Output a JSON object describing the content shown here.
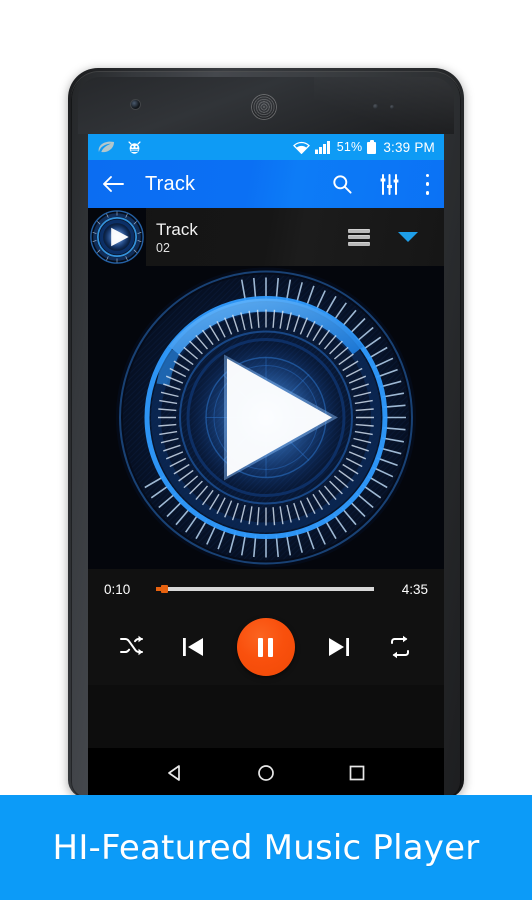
{
  "statusbar": {
    "icons_left": [
      "leaf-icon",
      "bug-icon"
    ],
    "wifi_icon": "wifi-icon",
    "signal_icon": "signal-bars-icon",
    "battery_percent": "51%",
    "battery_icon": "battery-icon",
    "clock": "3:39 PM"
  },
  "appbar": {
    "back_icon": "back-arrow-icon",
    "title": "Track",
    "search_icon": "search-icon",
    "equalizer_icon": "equalizer-icon",
    "overflow_icon": "overflow-menu-icon"
  },
  "nowplaying": {
    "art_icon": "album-art-play-icon",
    "title": "Track",
    "subtitle": "02",
    "queue_icon": "queue-list-icon",
    "collapse_icon": "chevron-down-icon"
  },
  "artwork": {
    "play_icon": "play-triangle-icon",
    "description": "circular hi-tech HUD visualizer with blue rings and tick marks"
  },
  "seekbar": {
    "current_time": "0:10",
    "total_time": "4:35",
    "progress_percent": 3.8
  },
  "controls": {
    "shuffle_icon": "shuffle-icon",
    "previous_icon": "skip-previous-icon",
    "play_pause_icon": "pause-icon",
    "next_icon": "skip-next-icon",
    "repeat_icon": "repeat-icon"
  },
  "navbar": {
    "back_icon": "nav-back-triangle-icon",
    "home_icon": "nav-home-circle-icon",
    "recents_icon": "nav-recents-square-icon"
  },
  "banner": {
    "text": "HI-Featured Music Player"
  },
  "colors": {
    "statusbar_blue": "#0e9bf5",
    "appbar_blue": "#0b72f5",
    "banner_blue": "#0c9bf8",
    "accent_orange": "#f9500d",
    "seek_orange": "#e8620f",
    "chevron_blue": "#1e9ee8",
    "screen_black": "#111111"
  }
}
